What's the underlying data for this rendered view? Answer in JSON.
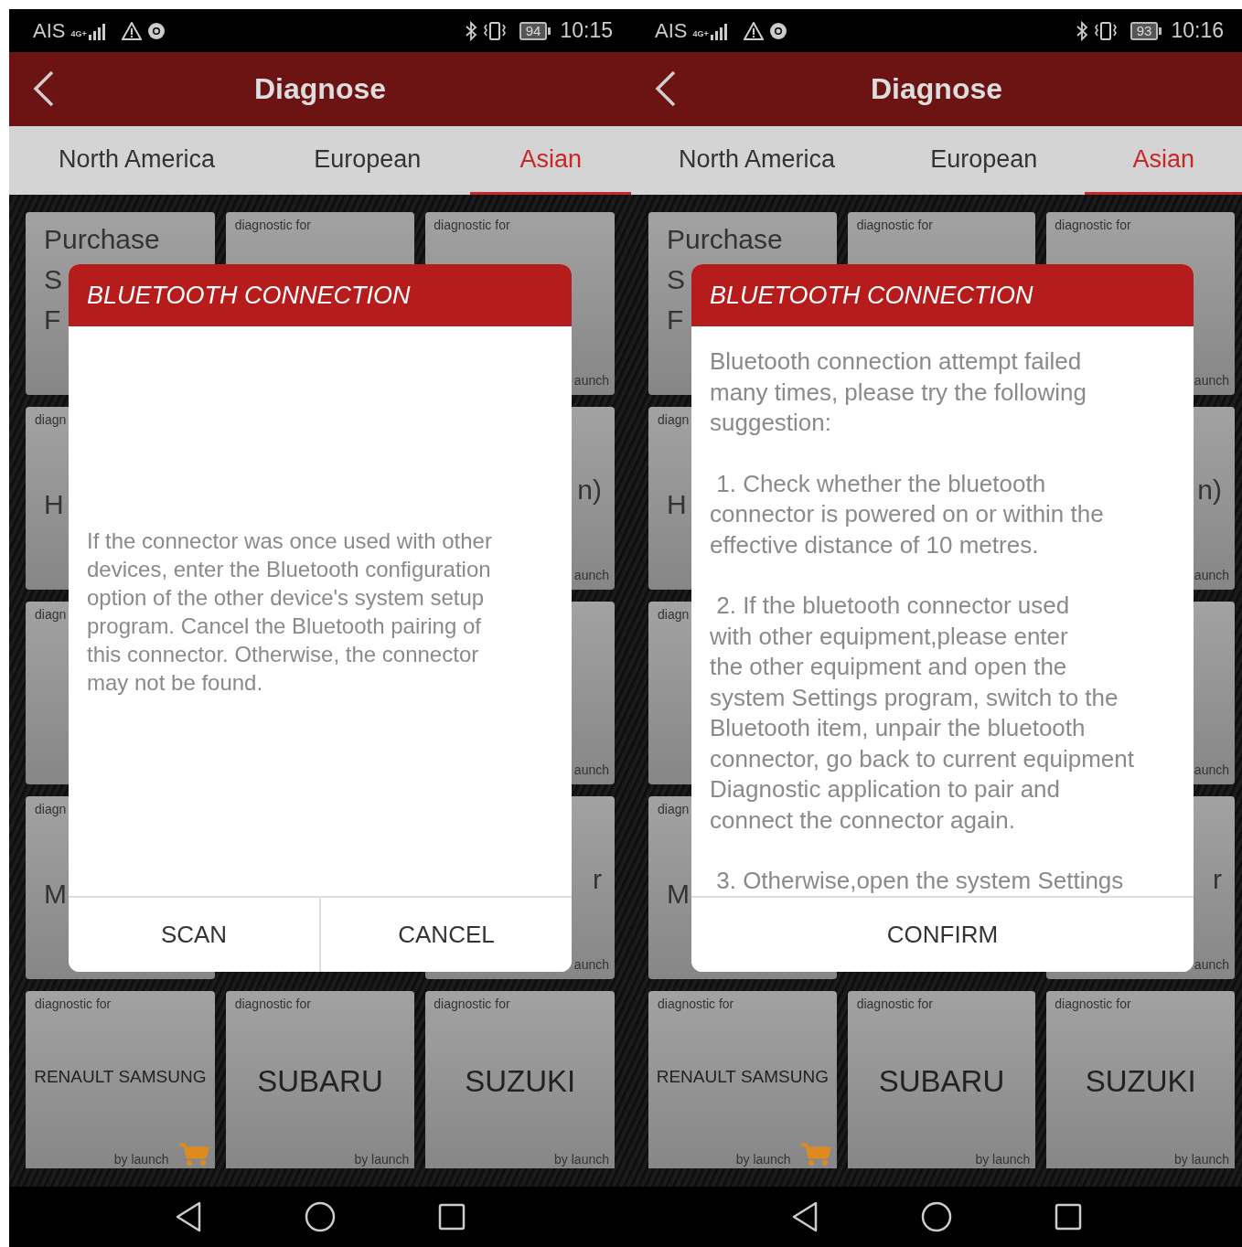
{
  "phones": [
    {
      "status_bar": {
        "carrier": "AIS",
        "network": "4G+",
        "battery": "94",
        "time": "10:15"
      },
      "header": {
        "title": "Diagnose"
      },
      "tabs": [
        {
          "label": "North America",
          "selected": false
        },
        {
          "label": "European",
          "selected": false
        },
        {
          "label": "Asian",
          "selected": true
        }
      ],
      "tile_rows": [
        [
          {
            "kind": "clipped",
            "name_lines": [
              "Purchase",
              "S",
              "F"
            ]
          },
          {
            "kind": "clipped",
            "caption": "diagnostic for"
          },
          {
            "kind": "clipped",
            "caption": "diagnostic for",
            "footer": "aunch"
          }
        ],
        [
          {
            "kind": "clipped",
            "caption": "diagn",
            "name_lines": [
              "H"
            ]
          },
          {
            "kind": "covered"
          },
          {
            "kind": "clipped",
            "name_lines": [
              "n)"
            ],
            "footer": "aunch"
          }
        ],
        [
          {
            "kind": "clipped",
            "caption": "diagn"
          },
          {
            "kind": "covered"
          },
          {
            "kind": "clipped",
            "footer": "aunch"
          }
        ],
        [
          {
            "kind": "clipped",
            "caption": "diagn",
            "name_lines": [
              "M"
            ]
          },
          {
            "kind": "covered"
          },
          {
            "kind": "clipped",
            "name_lines": [
              "r"
            ],
            "footer": "aunch"
          }
        ],
        [
          {
            "kind": "full",
            "caption": "diagnostic for",
            "name": "RENAULT SAMSUNG",
            "footer": "by launch",
            "cart": true
          },
          {
            "kind": "full",
            "caption": "diagnostic for",
            "name": "SUBARU",
            "footer": "by launch",
            "cart": false
          },
          {
            "kind": "full",
            "caption": "diagnostic for",
            "name": "SUZUKI",
            "footer": "by launch",
            "cart": false
          }
        ]
      ],
      "dialog": {
        "title": "BLUETOOTH CONNECTION",
        "kind": "notice",
        "paragraphs": [
          [
            "If the connector was once used with other",
            "devices, enter the Bluetooth configuration",
            "option of the other device's system setup",
            "program. Cancel the Bluetooth pairing of",
            "this connector. Otherwise, the connector",
            "may not be found."
          ]
        ],
        "buttons": [
          "SCAN",
          "CANCEL"
        ]
      }
    },
    {
      "status_bar": {
        "carrier": "AIS",
        "network": "4G+",
        "battery": "93",
        "time": "10:16"
      },
      "header": {
        "title": "Diagnose"
      },
      "tabs": [
        {
          "label": "North America",
          "selected": false
        },
        {
          "label": "European",
          "selected": false
        },
        {
          "label": "Asian",
          "selected": true
        }
      ],
      "tile_rows": [
        [
          {
            "kind": "clipped",
            "name_lines": [
              "Purchase",
              "S",
              "F"
            ]
          },
          {
            "kind": "clipped",
            "caption": "diagnostic for"
          },
          {
            "kind": "clipped",
            "caption": "diagnostic for",
            "footer": "aunch"
          }
        ],
        [
          {
            "kind": "clipped",
            "caption": "diagn",
            "name_lines": [
              "H"
            ]
          },
          {
            "kind": "covered"
          },
          {
            "kind": "clipped",
            "name_lines": [
              "n)"
            ],
            "footer": "aunch"
          }
        ],
        [
          {
            "kind": "clipped",
            "caption": "diagn"
          },
          {
            "kind": "covered"
          },
          {
            "kind": "clipped",
            "footer": "aunch"
          }
        ],
        [
          {
            "kind": "clipped",
            "caption": "diagn",
            "name_lines": [
              "M"
            ]
          },
          {
            "kind": "covered"
          },
          {
            "kind": "clipped",
            "name_lines": [
              "r"
            ],
            "footer": "aunch"
          }
        ],
        [
          {
            "kind": "full",
            "caption": "diagnostic for",
            "name": "RENAULT SAMSUNG",
            "footer": "by launch",
            "cart": true
          },
          {
            "kind": "full",
            "caption": "diagnostic for",
            "name": "SUBARU",
            "footer": "by launch",
            "cart": false
          },
          {
            "kind": "full",
            "caption": "diagnostic for",
            "name": "SUZUKI",
            "footer": "by launch",
            "cart": false
          }
        ]
      ],
      "dialog": {
        "title": "BLUETOOTH CONNECTION",
        "kind": "suggestions",
        "paragraphs": [
          [
            "Bluetooth connection attempt failed",
            "many times, please try the following",
            "suggestion:"
          ],
          [
            " 1. Check whether the bluetooth",
            "connector is powered on or within the",
            "effective distance of 10 metres."
          ],
          [
            " 2. If the bluetooth connector used",
            "with other equipment,please enter",
            "the other equipment and open the",
            "system Settings program, switch to the",
            "Bluetooth item, unpair the bluetooth",
            "connector, go back to current equipment",
            "Diagnostic application to pair and",
            "connect the connector again."
          ],
          [
            " 3. Otherwise,open the system Settings"
          ]
        ],
        "buttons": [
          "CONFIRM"
        ]
      }
    }
  ]
}
